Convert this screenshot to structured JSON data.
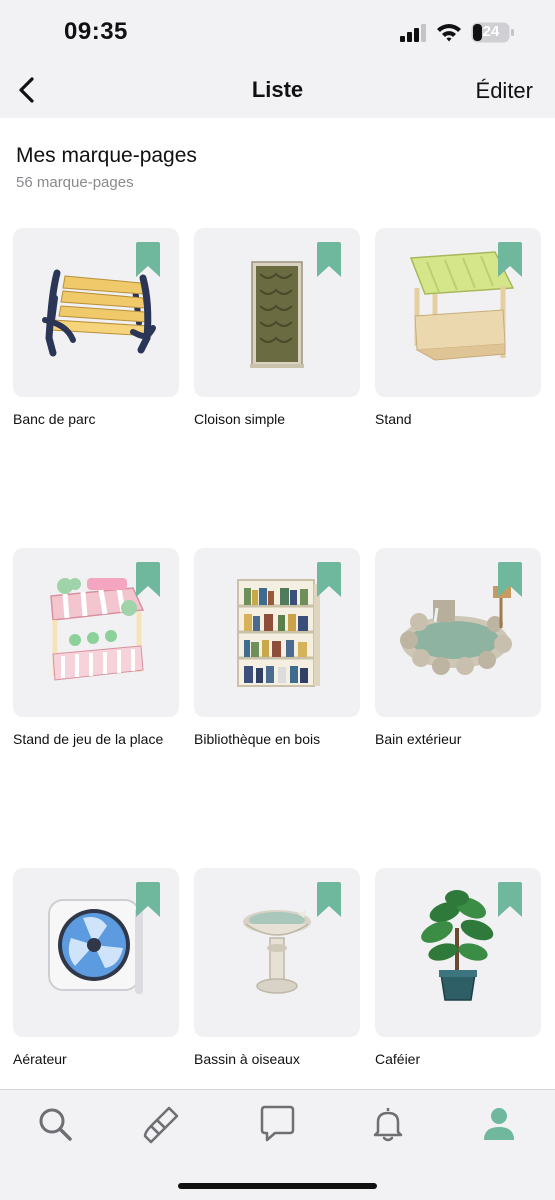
{
  "status_bar": {
    "time": "09:35",
    "battery": "24"
  },
  "nav": {
    "title": "Liste",
    "edit_label": "Éditer"
  },
  "section": {
    "title": "Mes marque-pages",
    "subtitle": "56 marque-pages"
  },
  "colors": {
    "accent": "#6fb79d",
    "card_bg": "#f1f1f4"
  },
  "items": [
    {
      "label": "Banc de parc",
      "icon": "park-bench"
    },
    {
      "label": "Cloison simple",
      "icon": "partition-screen"
    },
    {
      "label": "Stand",
      "icon": "stall"
    },
    {
      "label": "Stand de jeu de la place",
      "icon": "game-booth"
    },
    {
      "label": "Bibliothèque en bois",
      "icon": "bookshelf"
    },
    {
      "label": "Bain extérieur",
      "icon": "outdoor-bath"
    },
    {
      "label": "Aérateur",
      "icon": "ventilation-fan"
    },
    {
      "label": "Bassin à oiseaux",
      "icon": "birdbath"
    },
    {
      "label": "Caféier",
      "icon": "coffee-plant"
    }
  ],
  "tabs": [
    {
      "name": "search",
      "icon": "search-icon",
      "active": false
    },
    {
      "name": "diy",
      "icon": "paintbrush-icon",
      "active": false
    },
    {
      "name": "chat",
      "icon": "chat-icon",
      "active": false
    },
    {
      "name": "notifications",
      "icon": "bell-icon",
      "active": false
    },
    {
      "name": "profile",
      "icon": "profile-icon",
      "active": true
    }
  ]
}
